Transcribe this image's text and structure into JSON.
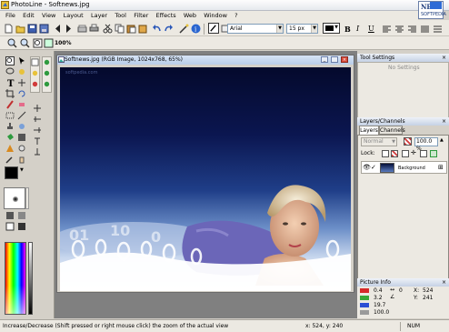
{
  "window": {
    "title": "PhotoLine - Softnews.jpg",
    "controls": [
      "minimize",
      "maximize",
      "close"
    ]
  },
  "watermark": {
    "line1": "NE",
    "line2": "SOFTPEDIA"
  },
  "menu": [
    "File",
    "Edit",
    "View",
    "Layout",
    "Layer",
    "Tool",
    "Filter",
    "Effects",
    "Web",
    "Window",
    "?"
  ],
  "text_toolbar": {
    "font": "Arial",
    "size": "15 px",
    "bold": "B",
    "italic": "I",
    "underline": "U"
  },
  "zoom_label": "100%",
  "image_window": {
    "title": "Softnews.jpg (RGB Image, 1024x768, 65%)",
    "watermark_text": "softpedia.com"
  },
  "tool_settings": {
    "title": "Tool Settings",
    "empty_text": "No Settings"
  },
  "layers": {
    "title": "Layers/Channels",
    "tabs": [
      "Layers",
      "Channels"
    ],
    "blend_mode": "Normal",
    "opacity": "100.0 %",
    "lock_label": "Lock:",
    "layer_name": "Background"
  },
  "picture_info": {
    "title": "Picture Info",
    "rows": [
      {
        "v1": "0.4",
        "v2": "0",
        "v3": "524"
      },
      {
        "v1": "3.2",
        "v2": "",
        "v3": "241"
      },
      {
        "v1": "19.7",
        "v2": "",
        "v3": ""
      },
      {
        "v1": "100.0",
        "v2": "",
        "v3": ""
      }
    ],
    "labels": {
      "x": "X:",
      "y": "Y:"
    },
    "colors": [
      "#d62a2a",
      "#38a838",
      "#2c4fd4",
      "#9a9a9a"
    ]
  },
  "status": {
    "message": "Increase/Decrease (Shift pressed or right mouse click) the zoom of the actual view",
    "coords": "x: 524, y: 240",
    "mode": "NUM"
  },
  "palette": {
    "fg": "#000000",
    "bg": "#ffffff",
    "accent": "#2e6bd6"
  }
}
